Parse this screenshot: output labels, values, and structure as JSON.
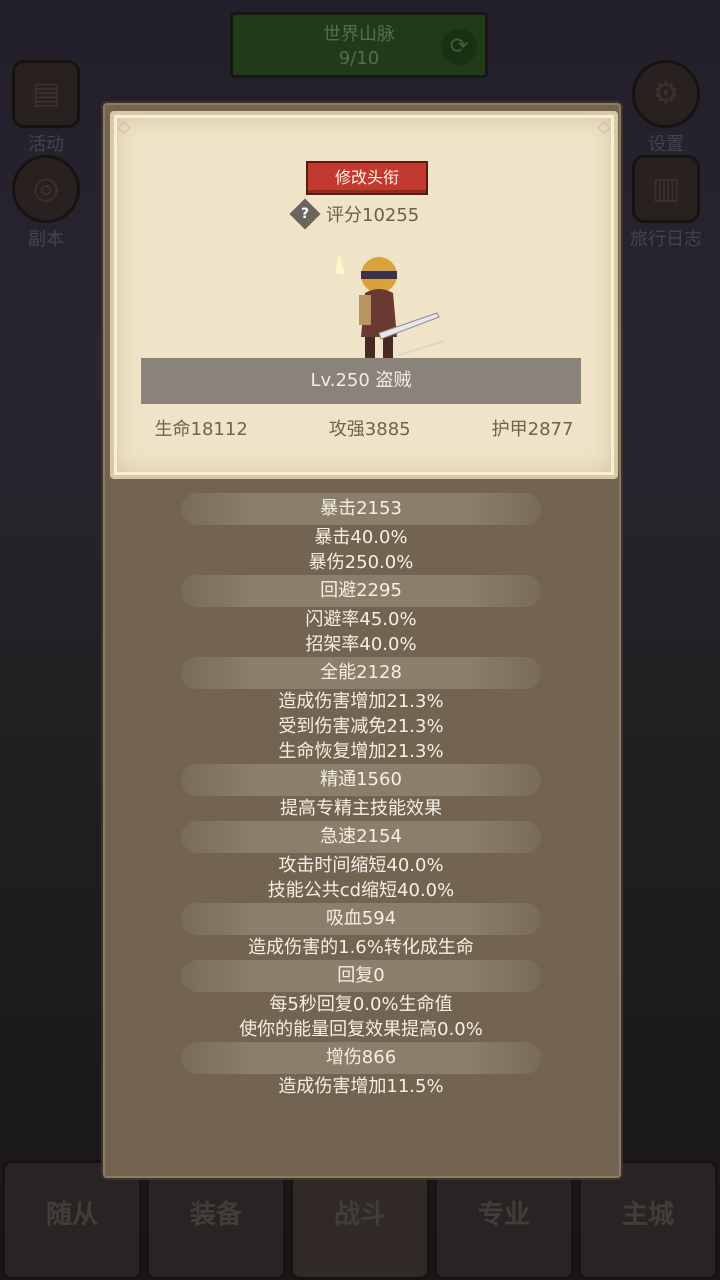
{
  "background": {
    "zone_name": "世界山脉",
    "zone_progress": "9/10",
    "left_buttons": [
      {
        "label": "活动",
        "icon": "scroll-icon"
      },
      {
        "label": "副本",
        "icon": "portal-icon"
      }
    ],
    "right_buttons": [
      {
        "label": "设置",
        "icon": "gear-icon"
      },
      {
        "label": "旅行日志",
        "icon": "book-icon"
      }
    ],
    "nav_tabs": [
      "随从",
      "装备",
      "战斗",
      "专业",
      "主城"
    ]
  },
  "panel": {
    "title_button": "修改头衔",
    "score": "评分10255",
    "level_text": "Lv.250 盗贼",
    "stats": [
      "生命18112",
      "攻强3885",
      "护甲2877"
    ],
    "sections": [
      {
        "head": "暴击2153",
        "lines": [
          "暴击40.0%",
          "暴伤250.0%"
        ]
      },
      {
        "head": "回避2295",
        "lines": [
          "闪避率45.0%",
          "招架率40.0%"
        ]
      },
      {
        "head": "全能2128",
        "lines": [
          "造成伤害增加21.3%",
          "受到伤害减免21.3%",
          "生命恢复增加21.3%"
        ]
      },
      {
        "head": "精通1560",
        "lines": [
          "提高专精主技能效果"
        ]
      },
      {
        "head": "急速2154",
        "lines": [
          "攻击时间缩短40.0%",
          "技能公共cd缩短40.0%"
        ]
      },
      {
        "head": "吸血594",
        "lines": [
          "造成伤害的1.6%转化成生命"
        ]
      },
      {
        "head": "回复0",
        "lines": [
          "每5秒回复0.0%生命值",
          "使你的能量回复效果提高0.0%"
        ]
      },
      {
        "head": "增伤866",
        "lines": [
          "造成伤害增加11.5%"
        ]
      }
    ]
  },
  "colors": {
    "title_button": "#c23a2f",
    "panel": "#726450",
    "paper": "#efe4c7"
  }
}
